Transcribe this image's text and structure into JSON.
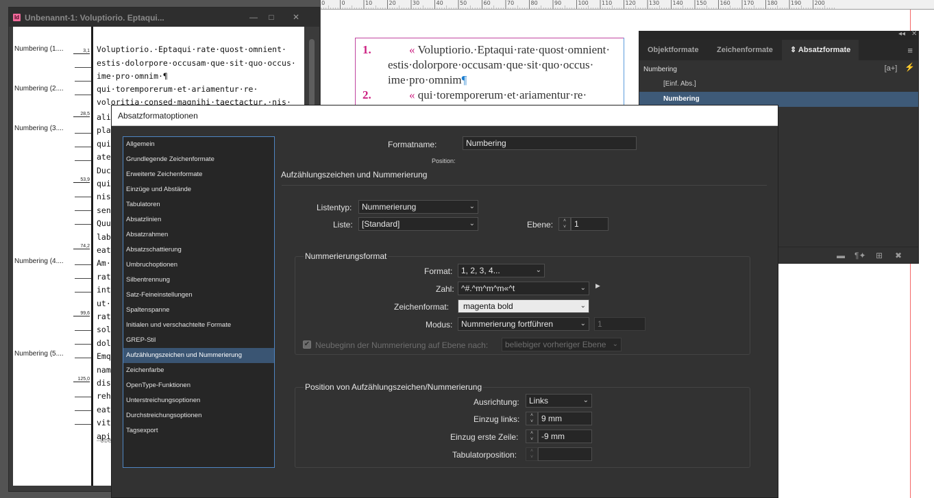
{
  "ruler": {
    "labels": [
      "10",
      "0",
      "10",
      "20",
      "30",
      "40",
      "50",
      "60",
      "70",
      "80",
      "90",
      "100",
      "110",
      "120",
      "130",
      "140",
      "150",
      "160",
      "170",
      "180",
      "190",
      "200"
    ]
  },
  "story_window": {
    "app_icon": "Id",
    "title": "Unbenannt-1: Voluptiorio. Eptaqui...",
    "minimize_icon": "—",
    "maximize_icon": "□",
    "close_icon": "✕",
    "paragraph_labels": [
      "Numbering (1....",
      "Numbering (2....",
      "Numbering (3....",
      "Numbering (4....",
      "Numbering (5...."
    ],
    "depth_marks": [
      "3,1",
      "28,5",
      "53,9",
      "74,2",
      "99,6",
      "125,0"
    ],
    "text_lines": [
      "Voluptiorio.·Eptaqui·rate·quost·omnient·",
      "estis·dolorpore·occusam·que·sit·quo·occus·",
      "ime·pro·omnim·¶",
      "qui·torem­porerum·et·ariamentur·re·",
      "voloritia·consed·magnihi·taectactur,·nis·"
    ],
    "short_lines": [
      "ali",
      "pla",
      "qui",
      "ate",
      "Duc",
      "qui",
      "nis",
      "sen",
      "Quu",
      "lab",
      "eat",
      "Am·",
      "rat",
      "int",
      "ut·",
      "rat",
      "sol",
      "dol",
      "Emq",
      "nam",
      "dis",
      "reh",
      "eat",
      "vit",
      "api"
    ],
    "footer_marker": "—Übe"
  },
  "layout_frame": {
    "line1_num": "1.",
    "line1_text": "Voluptiorio.·Eptaqui·rate·quost·omnient·",
    "line2_text": "estis·dolorpore·occusam·que·sit·quo·occus·",
    "line3_text": "ime·pro·omnim",
    "line3_pil": "¶",
    "line4_num": "2.",
    "line4_text": "qui·torem­porerum·et·ariamentur·re·",
    "quote_mark": "«"
  },
  "styles_panel": {
    "collapse_icon": "◂◂",
    "close_icon": "✕",
    "tabs": [
      "Objektformate",
      "Zeichenformate",
      "Absatzformate"
    ],
    "active_tab_icon": "⇕",
    "menu_icon": "≡",
    "current_style": "Numbering",
    "new_override_icon": "[a+]",
    "lightning_icon": "⚡",
    "rows": [
      "[Einf. Abs.]",
      "Numbering"
    ],
    "footer_icons": [
      "folder-icon",
      "pilcrow-icon",
      "new-style-icon",
      "trash-icon"
    ],
    "footer_glyphs": [
      "▬",
      "¶✦",
      "⊞",
      "✖"
    ]
  },
  "dialog": {
    "title": "Absatzformatoptionen",
    "categories": [
      "Allgemein",
      "Grundlegende Zeichenformate",
      "Erweiterte Zeichenformate",
      "Einzüge und Abstände",
      "Tabulatoren",
      "Absatzlinien",
      "Absatzrahmen",
      "Absatzschattierung",
      "Umbruchoptionen",
      "Silbentrennung",
      "Satz-Feineinstellungen",
      "Spaltenspanne",
      "Initialen und verschachtelte Formate",
      "GREP-Stil",
      "Aufzählungszeichen und Nummerierung",
      "Zeichenfarbe",
      "OpenType-Funktionen",
      "Unterstreichungsoptionen",
      "Durchstreichungsoptionen",
      "Tagsexport"
    ],
    "selected_category": "Aufzählungszeichen und Nummerierung",
    "formatname_label": "Formatname:",
    "formatname_value": "Numbering",
    "position_label": "Position:",
    "section_title": "Aufzählungszeichen und Nummerierung",
    "listentyp_label": "Listentyp:",
    "listentyp_value": "Nummerierung",
    "liste_label": "Liste:",
    "liste_value": "[Standard]",
    "ebene_label": "Ebene:",
    "ebene_value": "1",
    "numbering_group_title": "Nummerierungsformat",
    "format_label": "Format:",
    "format_value": "1, 2, 3, 4...",
    "zahl_label": "Zahl:",
    "zahl_value": "^#.^m^m^m«^t",
    "zeichenformat_label": "Zeichenformat:",
    "zeichenformat_value": "magenta bold",
    "modus_label": "Modus:",
    "modus_value": "Nummerierung fortführen",
    "modus_start_value": "1",
    "restart_label": "Neubeginn der Nummerierung auf Ebene nach:",
    "restart_value": "beliebiger vorheriger Ebene",
    "position_group_title": "Position von Aufzählungszeichen/Nummerierung",
    "ausrichtung_label": "Ausrichtung:",
    "ausrichtung_value": "Links",
    "einzug_links_label": "Einzug links:",
    "einzug_links_value": "9 mm",
    "einzug_erste_label": "Einzug erste Zeile:",
    "einzug_erste_value": "-9 mm",
    "tabulator_label": "Tabulatorposition:",
    "tabulator_value": ""
  },
  "icons": {
    "dropdown": "⌄",
    "up": "˄",
    "down": "˅",
    "flyout": "▶",
    "check": "✔"
  },
  "colors": {
    "accent_blue": "#3a5573",
    "magenta": "#cc1e80",
    "panel_bg": "#323232"
  }
}
